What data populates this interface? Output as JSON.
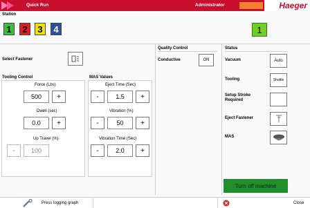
{
  "app": {
    "title": "Quick Run",
    "user": "Administrator",
    "brand": "Haeger"
  },
  "colors": {
    "brand_red": "#c8102e",
    "accent_green": "#1f8f2a",
    "station_indicator": "#6fcf2a"
  },
  "station": {
    "label": "Station",
    "buttons": [
      {
        "label": "1",
        "color": "#3fbf3f"
      },
      {
        "label": "2",
        "color": "#e31b23"
      },
      {
        "label": "3",
        "color": "#f4e100"
      },
      {
        "label": "4",
        "color": "#2d4fa0"
      }
    ],
    "current": "1"
  },
  "fastener": {
    "label": "Select Fastener",
    "icon": "fastener-icon"
  },
  "tooling_control": {
    "label": "Tooling Control",
    "force": {
      "label": "Force (Lbs)",
      "value": "500",
      "inc": "+"
    },
    "dwell": {
      "label": "Dwell (sec)",
      "value": "0.0",
      "inc": "+"
    },
    "up_travel": {
      "label": "Up Travel (%)",
      "value": "100",
      "dec": "-"
    }
  },
  "mas_values": {
    "label": "MAS Values",
    "eject_time": {
      "label": "Eject Time (Sec)",
      "value": "1.5",
      "dec": "-",
      "inc": "+"
    },
    "vibration": {
      "label": "Vibration (%)",
      "value": "50",
      "dec": "-",
      "inc": "+"
    },
    "vibration_time": {
      "label": "Vibration Time (Sec)",
      "value": "2.0",
      "dec": "-",
      "inc": "+"
    }
  },
  "quality_control": {
    "label": "Quality Control",
    "conductive_label": "Conductive",
    "conductive_value": "ON"
  },
  "status": {
    "label": "Status",
    "vacuum": {
      "label": "Vacuum",
      "value": "Auto"
    },
    "tooling": {
      "label": "Tooling",
      "value": "Shuttle"
    },
    "setup_stroke": {
      "label": "Setup Stroke Required"
    },
    "eject_fastener": {
      "label": "Eject Fastener"
    },
    "mas": {
      "label": "MAS"
    }
  },
  "turn_off_label": "Turn off machine",
  "bottom": {
    "logging_label": "Press logging graph",
    "close_label": "Close"
  }
}
